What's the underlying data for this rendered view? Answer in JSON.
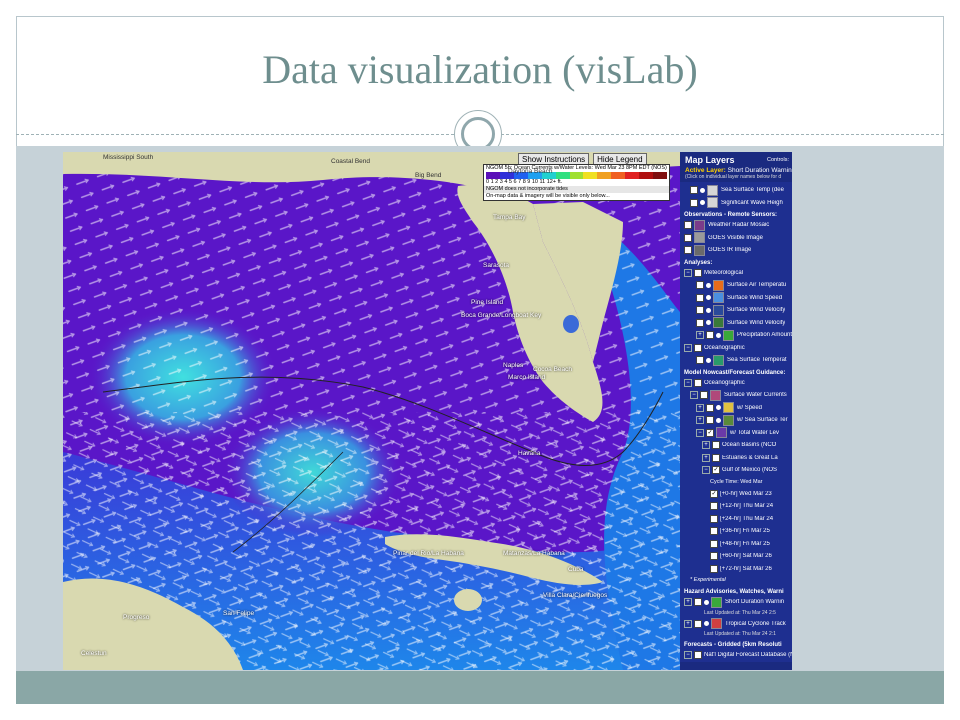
{
  "slide": {
    "title": "Data visualization (visLab)"
  },
  "map": {
    "toolbar": {
      "show_instructions": "Show Instructions",
      "hide_legend": "Hide Legend"
    },
    "legend": {
      "title": "NGOM 5h: Ocean Currents w/Water Levels: Wed Mar 23 8PM EDT (NOS)",
      "scale_values": [
        "0",
        "1",
        "2",
        "3",
        "4",
        "5",
        "6",
        "7",
        "8",
        "9",
        "10",
        "11",
        "12+"
      ],
      "scale_unit": "ft.",
      "note1": "NGOM does not incorporate tides",
      "note2": "On-map data & imagery will be visible only below..."
    },
    "labels": [
      {
        "text": "Mississippi South",
        "type": "land"
      },
      {
        "text": "Coastal Bend",
        "type": "land"
      },
      {
        "text": "Big Bend",
        "type": "land"
      },
      {
        "text": "Daytona Beach",
        "type": "land"
      },
      {
        "text": "Tampa Bay",
        "type": "water"
      },
      {
        "text": "Sarasota",
        "type": "water"
      },
      {
        "text": "Pine Island",
        "type": "water"
      },
      {
        "text": "Boca Grande/Longboat Key",
        "type": "water"
      },
      {
        "text": "Naples",
        "type": "water"
      },
      {
        "text": "Marco Island",
        "type": "water"
      },
      {
        "text": "Cocoa Beach",
        "type": "water"
      },
      {
        "text": "Havana",
        "type": "water"
      },
      {
        "text": "Pinar del Rio/La Habana",
        "type": "water"
      },
      {
        "text": "Cuba",
        "type": "water"
      },
      {
        "text": "Matanzas/La Habana",
        "type": "water"
      },
      {
        "text": "Villa Clara/Cienfuegos",
        "type": "water"
      },
      {
        "text": "San Felipe",
        "type": "water"
      },
      {
        "text": "Progreso",
        "type": "water"
      },
      {
        "text": "Celestun",
        "type": "water"
      }
    ]
  },
  "panel": {
    "title": "Map Layers",
    "controls": "Controls:",
    "active_layer_label": "Active Layer:",
    "active_layer_value": "Short Duration Warnin",
    "hint": "(Click on individual layer names below for d",
    "rows": [
      {
        "kind": "row",
        "indent": 2,
        "toggle": "",
        "check": false,
        "dot": true,
        "icon": "#d6d6d6",
        "label": "Sea Surface Temp (dee"
      },
      {
        "kind": "row",
        "indent": 2,
        "toggle": "",
        "check": false,
        "dot": true,
        "icon": "#d6d6d6",
        "label": "Significant Wave Heigh"
      },
      {
        "kind": "section",
        "label": "Observations - Remote Sensors:"
      },
      {
        "kind": "row",
        "indent": 1,
        "toggle": "",
        "check": false,
        "dot": false,
        "icon": "#7b3b8a",
        "label": "Weather Radar Mosaic"
      },
      {
        "kind": "row",
        "indent": 1,
        "toggle": "",
        "check": false,
        "dot": false,
        "icon": "#9a9a9a",
        "label": "GOES Visible Image"
      },
      {
        "kind": "row",
        "indent": 1,
        "toggle": "",
        "check": false,
        "dot": false,
        "icon": "#6a6a6a",
        "label": "GOES IR Image"
      },
      {
        "kind": "section",
        "label": "Analyses:"
      },
      {
        "kind": "row",
        "indent": 1,
        "toggle": "−",
        "check": false,
        "dot": false,
        "icon": "",
        "label": "Meteorological"
      },
      {
        "kind": "row",
        "indent": 3,
        "toggle": "",
        "check": false,
        "dot": true,
        "icon": "#e86c1a",
        "label": "Surface Air Temperatu"
      },
      {
        "kind": "row",
        "indent": 3,
        "toggle": "",
        "check": false,
        "dot": true,
        "icon": "#4a8fe0",
        "label": "Surface Wind Speed"
      },
      {
        "kind": "row",
        "indent": 3,
        "toggle": "",
        "check": false,
        "dot": true,
        "icon": "#2a4a9a",
        "label": "Surface Wind Velocity"
      },
      {
        "kind": "row",
        "indent": 3,
        "toggle": "",
        "check": false,
        "dot": true,
        "icon": "#3a7a3a",
        "label": "Surface Wind Velocity"
      },
      {
        "kind": "row",
        "indent": 3,
        "toggle": "+",
        "check": false,
        "dot": true,
        "icon": "#3aa83a",
        "label": "Precipitation Amount"
      },
      {
        "kind": "row",
        "indent": 1,
        "toggle": "−",
        "check": false,
        "dot": false,
        "icon": "",
        "label": "Oceanographic"
      },
      {
        "kind": "row",
        "indent": 3,
        "toggle": "",
        "check": false,
        "dot": true,
        "icon": "#2a9a6a",
        "label": "Sea Surface Temperat"
      },
      {
        "kind": "section",
        "label": "Model Nowcast/Forecast Guidance:"
      },
      {
        "kind": "row",
        "indent": 1,
        "toggle": "−",
        "check": false,
        "dot": false,
        "icon": "",
        "label": "Oceanographic"
      },
      {
        "kind": "row",
        "indent": 2,
        "toggle": "−",
        "check": false,
        "dot": false,
        "icon": "#b0487a",
        "label": "Surface Water Currents"
      },
      {
        "kind": "row",
        "indent": 3,
        "toggle": "+",
        "check": false,
        "dot": true,
        "icon": "#e0c040",
        "label": "w/ Speed"
      },
      {
        "kind": "row",
        "indent": 3,
        "toggle": "+",
        "check": false,
        "dot": true,
        "icon": "#5a8a3a",
        "label": "w/ Sea Surface Ter"
      },
      {
        "kind": "row",
        "indent": 3,
        "toggle": "−",
        "check": true,
        "dot": false,
        "icon": "#6a3aa8",
        "label": "w/ Total Water Lev"
      },
      {
        "kind": "row",
        "indent": 4,
        "toggle": "+",
        "check": false,
        "dot": false,
        "icon": "",
        "label": "Ocean Basins (NCO"
      },
      {
        "kind": "row",
        "indent": 4,
        "toggle": "+",
        "check": false,
        "dot": false,
        "icon": "",
        "label": "Estuaries & Great La"
      },
      {
        "kind": "row",
        "indent": 4,
        "toggle": "−",
        "check": true,
        "dot": false,
        "icon": "",
        "label": "Gulf of Mexico (NOS"
      },
      {
        "kind": "cycle",
        "label": "Cycle Time: Wed Mar"
      },
      {
        "kind": "row",
        "indent": 5,
        "toggle": "",
        "check": true,
        "dot": false,
        "icon": "",
        "label": "[+0-hr] Wed Mar 23"
      },
      {
        "kind": "row",
        "indent": 5,
        "toggle": "",
        "check": false,
        "dot": false,
        "icon": "",
        "label": "[+12-hr] Thu Mar 24"
      },
      {
        "kind": "row",
        "indent": 5,
        "toggle": "",
        "check": false,
        "dot": false,
        "icon": "",
        "label": "[+24-hr] Thu Mar 24"
      },
      {
        "kind": "row",
        "indent": 5,
        "toggle": "",
        "check": false,
        "dot": false,
        "icon": "",
        "label": "[+36-hr] Fri Mar 25"
      },
      {
        "kind": "row",
        "indent": 5,
        "toggle": "",
        "check": false,
        "dot": false,
        "icon": "",
        "label": "[+48-hr] Fri Mar 25"
      },
      {
        "kind": "row",
        "indent": 5,
        "toggle": "",
        "check": false,
        "dot": false,
        "icon": "",
        "label": "[+60-hr] Sat Mar 26"
      },
      {
        "kind": "row",
        "indent": 5,
        "toggle": "",
        "check": false,
        "dot": false,
        "icon": "",
        "label": "[+72-hr] Sat Mar 26"
      },
      {
        "kind": "note",
        "label": "* Experimental"
      },
      {
        "kind": "section",
        "label": "Hazard Advisories, Watches, Warni"
      },
      {
        "kind": "row",
        "indent": 1,
        "toggle": "+",
        "check": false,
        "dot": true,
        "icon": "#3aa83a",
        "label": "Short Duration Warnin"
      },
      {
        "kind": "sub",
        "label": "Last Updated at: Thu Mar 24 2:5"
      },
      {
        "kind": "row",
        "indent": 1,
        "toggle": "+",
        "check": false,
        "dot": true,
        "icon": "#d04040",
        "label": "Tropical Cyclone Track"
      },
      {
        "kind": "sub",
        "label": "Last Updated at: Thu Mar 24 2:1"
      },
      {
        "kind": "section",
        "label": "Forecasts - Gridded (5km Resoluti"
      },
      {
        "kind": "row",
        "indent": 1,
        "toggle": "−",
        "check": false,
        "dot": false,
        "icon": "",
        "label": "Nat'l Digital Forecast Database (N"
      }
    ]
  },
  "colors": {
    "title": "#6e8e8e",
    "band": "#c6d2d8",
    "bottom_band": "#8aa7a6",
    "panel_bg": "#1a2a80",
    "ocean_purple": "#5a16c8",
    "ocean_blue": "#1e78e6",
    "land": "#d9d9b0"
  }
}
